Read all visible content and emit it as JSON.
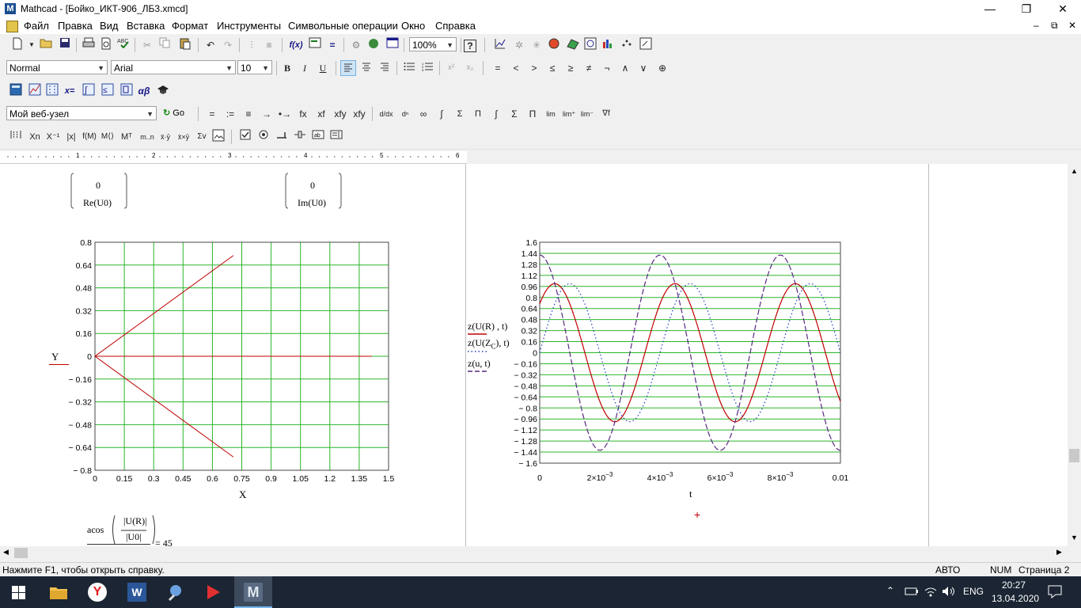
{
  "window": {
    "title": "Mathcad - [Бойко_ИКТ-906_ЛБ3.xmcd]",
    "app_icon_letter": "M",
    "controls": {
      "minimize": "—",
      "maximize": "❐",
      "close": "✕"
    },
    "doc_controls": {
      "minimize": "–",
      "restore": "⧉",
      "close": "✕"
    }
  },
  "menu": {
    "items": [
      {
        "label": "Файл"
      },
      {
        "label": "Правка"
      },
      {
        "label": "Вид"
      },
      {
        "label": "Вставка"
      },
      {
        "label": "Формат"
      },
      {
        "label": "Инструменты"
      },
      {
        "label": "Символьные операции"
      },
      {
        "label": "Окно"
      },
      {
        "label": "Справка"
      }
    ]
  },
  "toolbar_standard": {
    "zoom": "100%"
  },
  "toolbar_format": {
    "style": "Normal",
    "font": "Arial",
    "size": "10",
    "bold": "B",
    "italic": "I",
    "underline": "U",
    "operators": [
      "=",
      "<",
      ">",
      "≤",
      "≥",
      "≠",
      "¬",
      "∧",
      "∨",
      "⊕"
    ]
  },
  "toolbar_math": {
    "labels": [
      "x=",
      "αβ"
    ]
  },
  "toolbar_web": {
    "address": "Мой веб-узел",
    "go": "Go",
    "eval_ops": [
      "=",
      ":=",
      "≡",
      "→",
      "•→",
      "fx",
      "xf",
      "xfy",
      "xfy"
    ],
    "calculus_ops": [
      "∞",
      "∫",
      "Σ",
      "Π",
      "lim"
    ]
  },
  "toolbar_matrix": {
    "labels": [
      "Xn",
      "X⁻¹",
      "|x|",
      "Mᵀ",
      "m..n",
      "Σv"
    ]
  },
  "ruler": {
    "marks": [
      "1",
      "2",
      "3",
      "4",
      "5",
      "6"
    ]
  },
  "worksheet": {
    "results": [
      {
        "value": "0",
        "label": "Re(U0)"
      },
      {
        "value": "0",
        "label": "Im(U0)"
      }
    ],
    "plot1": {
      "y_var": "Y",
      "x_var": "X",
      "y_ticks": [
        "0.8",
        "0.64",
        "0.48",
        "0.32",
        "0.16",
        "0",
        "− 0.16",
        "− 0.32",
        "− 0.48",
        "− 0.64",
        "− 0.8"
      ],
      "x_ticks": [
        "0",
        "0.15",
        "0.3",
        "0.45",
        "0.6",
        "0.75",
        "0.9",
        "1.05",
        "1.2",
        "1.35",
        "1.5"
      ]
    },
    "plot2": {
      "legend": [
        "z(U(R) , t)",
        "z(U(Z",
        "C",
        "), t)",
        "z(u, t)"
      ],
      "x_var": "t",
      "y_ticks": [
        "1.6",
        "1.44",
        "1.28",
        "1.12",
        "0.96",
        "0.8",
        "0.64",
        "0.48",
        "0.32",
        "0.16",
        "0",
        "− 0.16",
        "− 0.32",
        "− 0.48",
        "− 0.64",
        "− 0.8",
        "− 0.96",
        "− 1.12",
        "− 1.28",
        "− 1.44",
        "− 1.6"
      ],
      "x_ticks": [
        {
          "base": "0",
          "exp": ""
        },
        {
          "base": "2×10",
          "exp": "−3"
        },
        {
          "base": "4×10",
          "exp": "−3"
        },
        {
          "base": "6×10",
          "exp": "−3"
        },
        {
          "base": "8×10",
          "exp": "−3"
        },
        {
          "base": "0.01",
          "exp": ""
        }
      ]
    },
    "formula": {
      "func": "acos",
      "numerator": "|U(R)|",
      "denominator": "|U0|",
      "result": "= 45"
    }
  },
  "chart_data": [
    {
      "type": "line",
      "title": "",
      "xlabel": "X",
      "ylabel": "Y",
      "xlim": [
        0,
        1.5
      ],
      "ylim": [
        -0.8,
        0.8
      ],
      "grid": true,
      "series": [
        {
          "x": [
            0,
            0.707
          ],
          "y": [
            0,
            0.707
          ],
          "color": "#c00000"
        },
        {
          "x": [
            0,
            1.414
          ],
          "y": [
            0,
            0
          ],
          "color": "#c00000"
        },
        {
          "x": [
            0,
            0.707
          ],
          "y": [
            0,
            -0.707
          ],
          "color": "#c00000"
        }
      ]
    },
    {
      "type": "line",
      "title": "",
      "xlabel": "t",
      "ylabel": "",
      "xlim": [
        0,
        0.01
      ],
      "ylim": [
        -1.6,
        1.6
      ],
      "grid": true,
      "series": [
        {
          "name": "z(U(R) , t)",
          "amplitude": 1.0,
          "period": 0.004,
          "phase_deg": 45,
          "style": "solid",
          "color": "#c00000"
        },
        {
          "name": "z(U(ZC), t)",
          "amplitude": 1.414,
          "period": 0.004,
          "phase_deg": 90,
          "style": "dashed",
          "color": "#5a2a82"
        },
        {
          "name": "z(u, t)",
          "amplitude": 1.0,
          "period": 0.004,
          "phase_deg": 0,
          "style": "dotted",
          "color": "#1f3fbf"
        }
      ]
    }
  ],
  "status": {
    "help": "Нажмите F1, чтобы открыть справку.",
    "mode": "АВТО",
    "num": "NUM",
    "page": "Страница 2"
  },
  "taskbar": {
    "lang": "ENG",
    "time": "20:27",
    "date": "13.04.2020",
    "word_letter": "W",
    "mathcad_letter": "M"
  }
}
